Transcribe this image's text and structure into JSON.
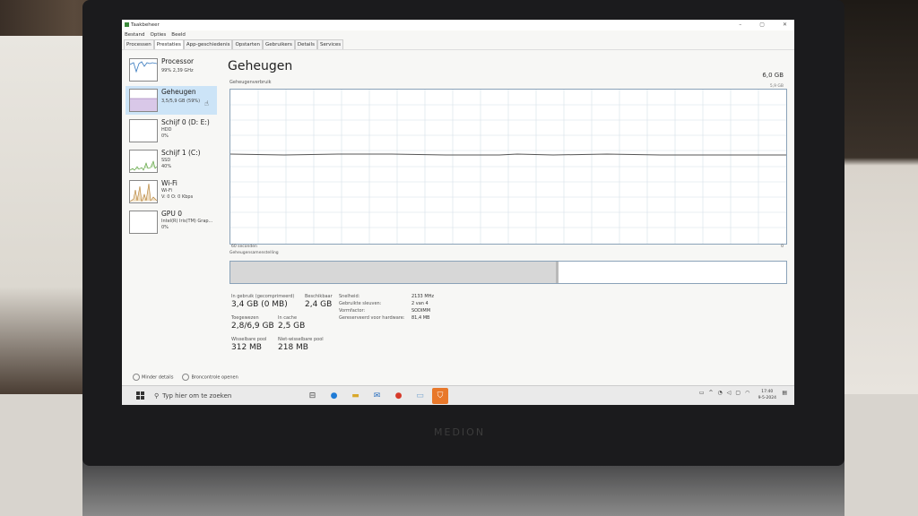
{
  "window": {
    "title": "Taakbeheer",
    "controls": [
      "–",
      "▢",
      "✕"
    ]
  },
  "menu": [
    "Bestand",
    "Opties",
    "Beeld"
  ],
  "tabs": [
    {
      "label": "Processen",
      "active": false
    },
    {
      "label": "Prestaties",
      "active": true
    },
    {
      "label": "App-geschiedenis",
      "active": false
    },
    {
      "label": "Opstarten",
      "active": false
    },
    {
      "label": "Gebruikers",
      "active": false
    },
    {
      "label": "Details",
      "active": false
    },
    {
      "label": "Services",
      "active": false
    }
  ],
  "sidebar": {
    "items": [
      {
        "name": "Processor",
        "sub1": "99% 2,39 GHz",
        "sub2": "",
        "sub3": ""
      },
      {
        "name": "Geheugen",
        "sub1": "3,5/5,9 GB (59%)",
        "sub2": "",
        "sub3": ""
      },
      {
        "name": "Schijf 0 (D: E:)",
        "sub1": "HDD",
        "sub2": "0%",
        "sub3": ""
      },
      {
        "name": "Schijf 1 (C:)",
        "sub1": "SSD",
        "sub2": "40%",
        "sub3": ""
      },
      {
        "name": "Wi-Fi",
        "sub1": "Wi-Fi",
        "sub2": "V: 0 O: 0 Kbps",
        "sub3": ""
      },
      {
        "name": "GPU 0",
        "sub1": "Intel(R) Iris(TM) Grap...",
        "sub2": "0%",
        "sub3": ""
      }
    ]
  },
  "main": {
    "title": "Geheugen",
    "total": "6,0 GB",
    "usage_label": "Geheugenverbruik",
    "usage_max": "5,9 GB",
    "axis_left": "60 seconden",
    "axis_right": "0",
    "composition_label": "Geheugensamenstelling",
    "composition_used_fraction": 0.585
  },
  "stats": {
    "in_use_label": "In gebruik (gecomprimeerd)",
    "in_use_value": "3,4 GB (0 MB)",
    "available_label": "Beschikbaar",
    "available_value": "2,4 GB",
    "committed_label": "Toegewezen",
    "committed_value": "2,8/6,9 GB",
    "cached_label": "In cache",
    "cached_value": "2,5 GB",
    "paged_label": "Wisselbare pool",
    "paged_value": "312 MB",
    "nonpaged_label": "Niet-wisselbare pool",
    "nonpaged_value": "218 MB"
  },
  "info": [
    {
      "k": "Snelheid:",
      "v": "2133 MHz"
    },
    {
      "k": "Gebruikte sleuven:",
      "v": "2 van 4"
    },
    {
      "k": "Vormfactor:",
      "v": "SODIMM"
    },
    {
      "k": "Gereserveerd voor hardware:",
      "v": "81,4 MB"
    }
  ],
  "footer": {
    "less_details": "Minder details",
    "resource_monitor": "Broncontrole openen"
  },
  "taskbar": {
    "search_placeholder": "Typ hier om te zoeken",
    "time": "17:40",
    "date": "9-5-2024"
  },
  "brand": "MEDION",
  "colors": {
    "graph_border": "#8aa2b8",
    "selected_item": "#cce4f7",
    "accent_orange": "#e8782a"
  }
}
